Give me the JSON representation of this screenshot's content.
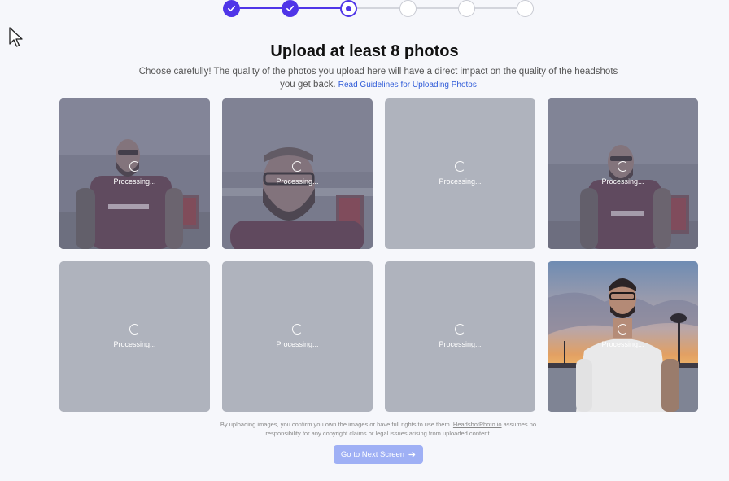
{
  "header": {
    "title": "Upload at least 8 photos",
    "subtitle": "Choose carefully! The quality of the photos you upload here will have a direct impact on the quality of the headshots you get back.",
    "guidelines_link": "Read Guidelines for Uploading Photos"
  },
  "stepper": {
    "steps": [
      "done",
      "done",
      "current",
      "todo",
      "todo",
      "todo"
    ],
    "accent_color": "#4f35e8"
  },
  "photos": [
    {
      "status": "Processing..."
    },
    {
      "status": "Processing..."
    },
    {
      "status": "Processing..."
    },
    {
      "status": "Processing..."
    },
    {
      "status": "Processing..."
    },
    {
      "status": "Processing..."
    },
    {
      "status": "Processing..."
    },
    {
      "status": "Processing..."
    }
  ],
  "footer": {
    "disclaimer_part1": "By uploading images, you confirm you own the images or have full rights to use them.",
    "brand": "HeadshotPhoto.io",
    "disclaimer_part2": "assumes no responsibility for any copyright claims or legal issues arising from uploaded content.",
    "next_button": "Go to Next Screen",
    "next_button_icon": "arrow-right-icon"
  }
}
